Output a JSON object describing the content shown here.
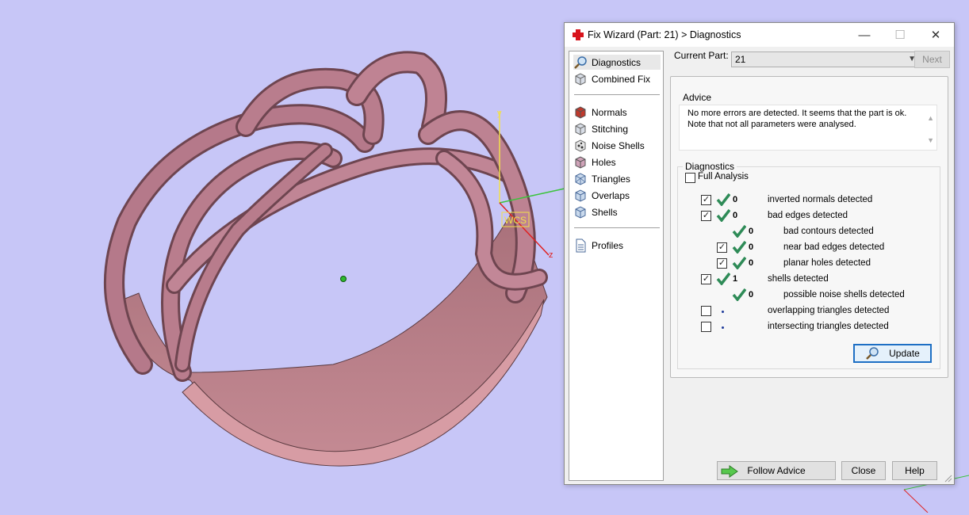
{
  "viewport": {
    "background": "#c7c6f7",
    "ring_color": "#b87f87",
    "wcs_label": "WCS",
    "axis_y": "y",
    "axis_z": "z"
  },
  "dialog": {
    "title": "Fix Wizard (Part: 21) > Diagnostics",
    "title_icon": "red-cross-icon",
    "window_buttons": {
      "minimize": "—",
      "maximize": "☐",
      "close": "✕"
    },
    "nav": {
      "top_items": [
        {
          "label": "Diagnostics",
          "icon": "magnifier-icon",
          "selected": true
        },
        {
          "label": "Combined Fix",
          "icon": "cube-icon"
        }
      ],
      "fix_items": [
        {
          "label": "Normals",
          "icon": "normals-cube-icon"
        },
        {
          "label": "Stitching",
          "icon": "stitching-cube-icon"
        },
        {
          "label": "Noise Shells",
          "icon": "noise-shells-icon"
        },
        {
          "label": "Holes",
          "icon": "holes-cube-icon"
        },
        {
          "label": "Triangles",
          "icon": "triangles-cube-icon"
        },
        {
          "label": "Overlaps",
          "icon": "overlaps-cube-icon"
        },
        {
          "label": "Shells",
          "icon": "shells-cube-icon"
        }
      ],
      "profiles": {
        "label": "Profiles",
        "icon": "document-icon"
      }
    },
    "current_part": {
      "label": "Current Part:",
      "value": "21"
    },
    "next_label": "Next",
    "advice": {
      "title": "Advice",
      "text_line1": "No more errors are detected. It seems that the part is ok.",
      "text_line2": "Note that not all parameters were analysed."
    },
    "diagnostics": {
      "title": "Diagnostics",
      "full_analysis_label": "Full Analysis",
      "full_analysis_checked": false,
      "rows": [
        {
          "checkbox": true,
          "checked": true,
          "status": "ok",
          "count": "0",
          "label": "inverted normals detected",
          "indent": 0
        },
        {
          "checkbox": true,
          "checked": true,
          "status": "ok",
          "count": "0",
          "label": "bad edges detected",
          "indent": 0
        },
        {
          "checkbox": false,
          "checked": false,
          "status": "ok",
          "count": "0",
          "label": "bad contours detected",
          "indent": 1
        },
        {
          "checkbox": true,
          "checked": true,
          "status": "ok",
          "count": "0",
          "label": "near bad edges detected",
          "indent": 1
        },
        {
          "checkbox": true,
          "checked": true,
          "status": "ok",
          "count": "0",
          "label": "planar holes detected",
          "indent": 1
        },
        {
          "checkbox": true,
          "checked": true,
          "status": "ok",
          "count": "1",
          "label": "shells detected",
          "indent": 0
        },
        {
          "checkbox": false,
          "checked": false,
          "status": "ok",
          "count": "0",
          "label": "possible noise shells detected",
          "indent": 1
        },
        {
          "checkbox": true,
          "checked": false,
          "status": "pending",
          "count": "",
          "label": "overlapping triangles detected",
          "indent": 0
        },
        {
          "checkbox": true,
          "checked": false,
          "status": "pending",
          "count": "",
          "label": "intersecting triangles detected",
          "indent": 0
        }
      ],
      "update_label": "Update"
    },
    "footer": {
      "follow_advice_label": "Follow Advice",
      "close_label": "Close",
      "help_label": "Help"
    }
  }
}
